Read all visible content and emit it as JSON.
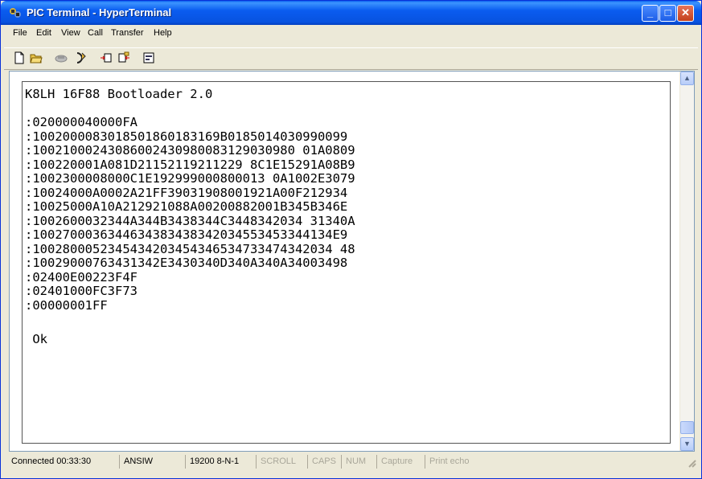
{
  "window": {
    "title": "PIC Terminal - HyperTerminal",
    "minimize": "_",
    "maximize": "□",
    "close": "✕"
  },
  "menu": [
    "File",
    "Edit",
    "View",
    "Call",
    "Transfer",
    "Help"
  ],
  "toolbar": {
    "icons": [
      "new-document-icon",
      "open-folder-icon",
      "phone-disconnect-icon",
      "call-icon",
      "send-file-icon",
      "receive-file-icon",
      "properties-icon"
    ]
  },
  "terminal": {
    "lines": [
      "K8LH 16F88 Bootloader 2.0",
      "",
      ":020000040000FA",
      ":1002000083018501860183169B0185014030990099",
      ":10021000243086002430980083129030980 01A0809",
      ":100220001A081D21152119211229 8C1E15291A08B9",
      ":1002300008000C1E192999000800013 0A1002E3079",
      ":10024000A0002A21FF39031908001921A00F212934",
      ":10025000A10A212921088A00200882001B345B346E",
      ":1002600032344A344B3438344C3448342034 31340A",
      ":1002700036344634383438342034553453344134E9",
      ":1002800052345434203454346534733474342034 48",
      ":10029000763431342E3430340D340A340A34003498",
      ":02400E00223F4F",
      ":02401000FC3F73",
      ":00000001FF",
      "",
      " Ok"
    ]
  },
  "status": {
    "connected": "Connected 00:33:30",
    "emulation": "ANSIW",
    "port_settings": "19200 8-N-1",
    "scroll": "SCROLL",
    "caps": "CAPS",
    "num": "NUM",
    "capture": "Capture",
    "print_echo": "Print echo"
  }
}
